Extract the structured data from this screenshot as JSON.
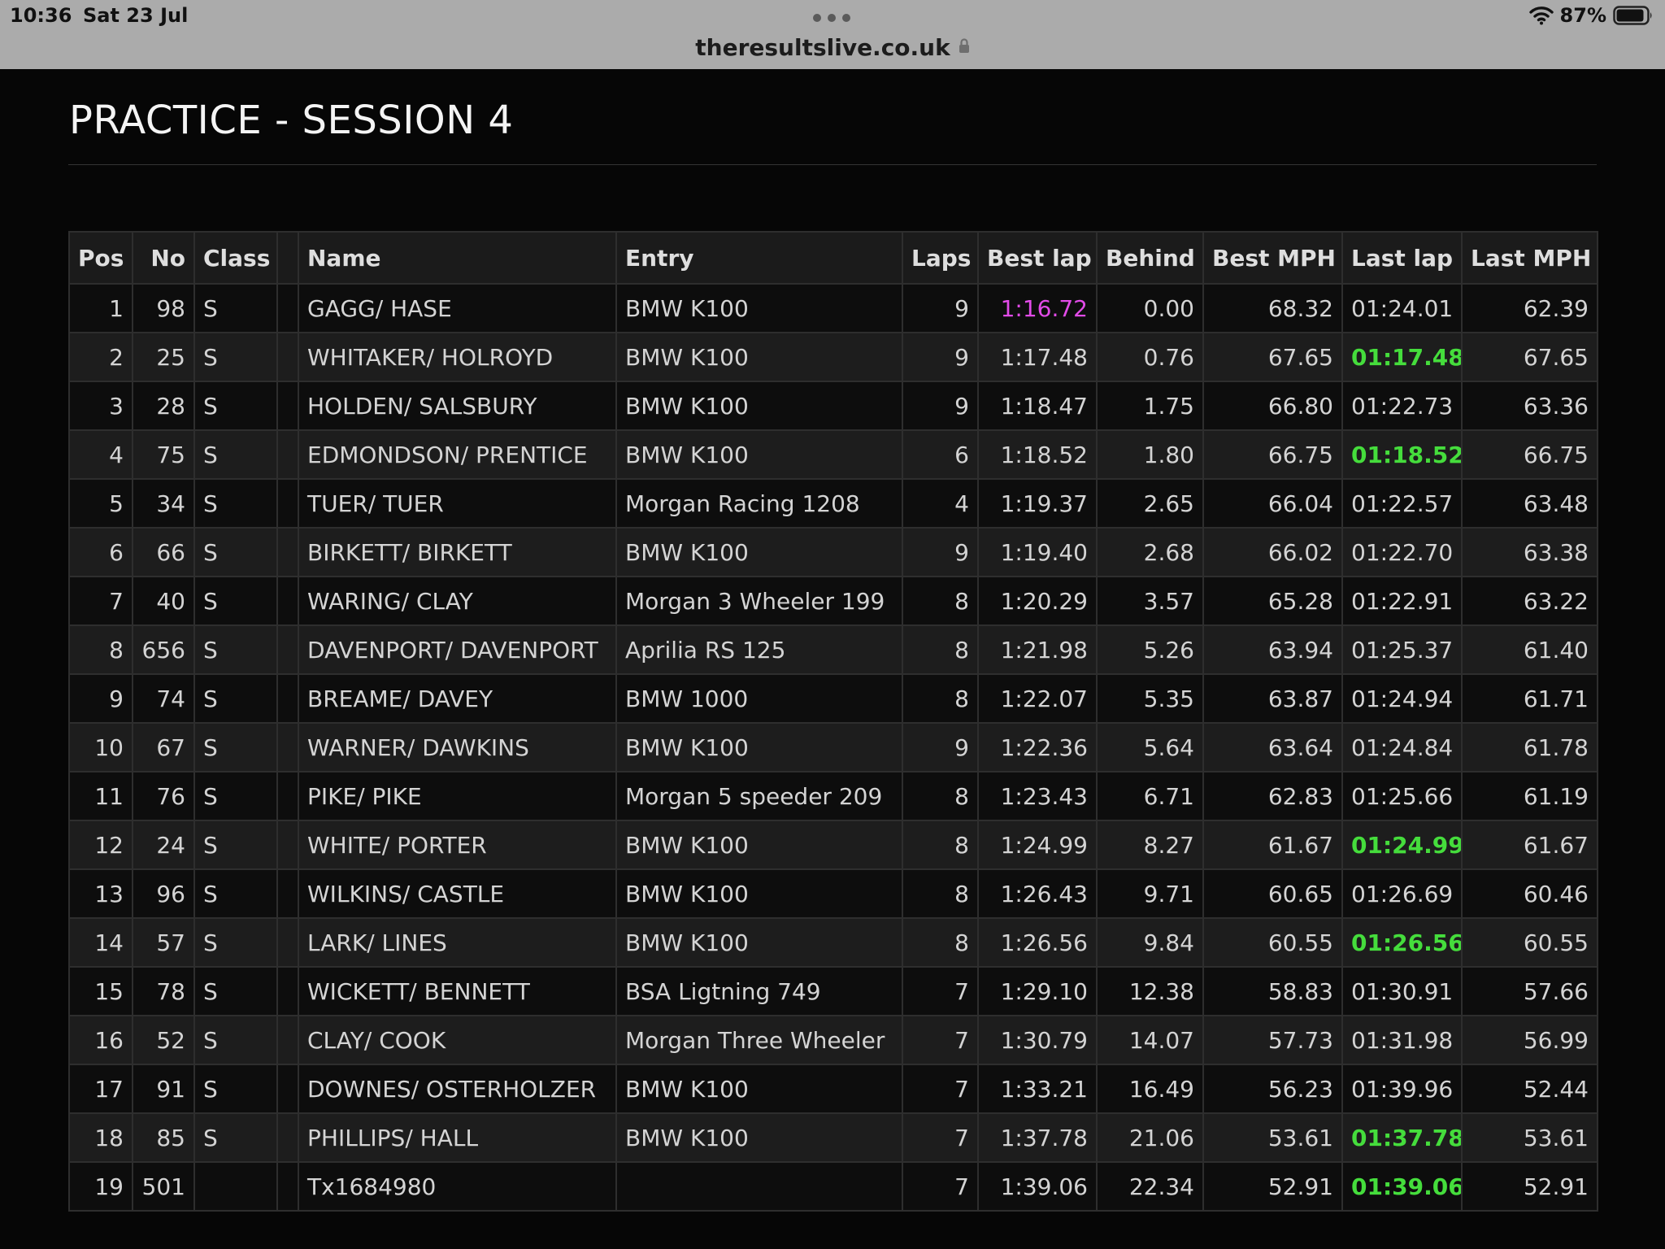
{
  "status_bar": {
    "time": "10:36",
    "date": "Sat 23 Jul",
    "battery": "87%"
  },
  "browser": {
    "url": "theresultslive.co.uk",
    "icons": [
      "lock-icon",
      "wifi-icon",
      "battery-icon",
      "more-dots-icon"
    ]
  },
  "page": {
    "title": "PRACTICE - SESSION 4"
  },
  "colors": {
    "fastest_overall": "#e24be8",
    "personal_best": "#45dd3c"
  },
  "table": {
    "headers": [
      "Pos",
      "No",
      "Class",
      "",
      "Name",
      "Entry",
      "Laps",
      "Best lap",
      "Behind",
      "Best MPH",
      "Last lap",
      "Last MPH"
    ],
    "rows": [
      {
        "pos": "1",
        "no": "98",
        "class": "S",
        "name": "GAGG/ HASE",
        "entry": "BMW K100",
        "laps": "9",
        "best_lap": "1:16.72",
        "behind": "0.00",
        "best_mph": "68.32",
        "last_lap": "01:24.01",
        "last_mph": "62.39",
        "best_lap_style": "purple",
        "last_lap_style": ""
      },
      {
        "pos": "2",
        "no": "25",
        "class": "S",
        "name": "WHITAKER/ HOLROYD",
        "entry": "BMW K100",
        "laps": "9",
        "best_lap": "1:17.48",
        "behind": "0.76",
        "best_mph": "67.65",
        "last_lap": "01:17.48",
        "last_mph": "67.65",
        "best_lap_style": "",
        "last_lap_style": "green"
      },
      {
        "pos": "3",
        "no": "28",
        "class": "S",
        "name": "HOLDEN/ SALSBURY",
        "entry": "BMW K100",
        "laps": "9",
        "best_lap": "1:18.47",
        "behind": "1.75",
        "best_mph": "66.80",
        "last_lap": "01:22.73",
        "last_mph": "63.36",
        "best_lap_style": "",
        "last_lap_style": ""
      },
      {
        "pos": "4",
        "no": "75",
        "class": "S",
        "name": "EDMONDSON/ PRENTICE",
        "entry": "BMW K100",
        "laps": "6",
        "best_lap": "1:18.52",
        "behind": "1.80",
        "best_mph": "66.75",
        "last_lap": "01:18.52",
        "last_mph": "66.75",
        "best_lap_style": "",
        "last_lap_style": "green"
      },
      {
        "pos": "5",
        "no": "34",
        "class": "S",
        "name": "TUER/ TUER",
        "entry": "Morgan Racing 1208",
        "laps": "4",
        "best_lap": "1:19.37",
        "behind": "2.65",
        "best_mph": "66.04",
        "last_lap": "01:22.57",
        "last_mph": "63.48",
        "best_lap_style": "",
        "last_lap_style": ""
      },
      {
        "pos": "6",
        "no": "66",
        "class": "S",
        "name": "BIRKETT/ BIRKETT",
        "entry": "BMW K100",
        "laps": "9",
        "best_lap": "1:19.40",
        "behind": "2.68",
        "best_mph": "66.02",
        "last_lap": "01:22.70",
        "last_mph": "63.38",
        "best_lap_style": "",
        "last_lap_style": ""
      },
      {
        "pos": "7",
        "no": "40",
        "class": "S",
        "name": "WARING/ CLAY",
        "entry": "Morgan 3 Wheeler 199",
        "laps": "8",
        "best_lap": "1:20.29",
        "behind": "3.57",
        "best_mph": "65.28",
        "last_lap": "01:22.91",
        "last_mph": "63.22",
        "best_lap_style": "",
        "last_lap_style": ""
      },
      {
        "pos": "8",
        "no": "656",
        "class": "S",
        "name": "DAVENPORT/ DAVENPORT",
        "entry": "Aprilia RS 125",
        "laps": "8",
        "best_lap": "1:21.98",
        "behind": "5.26",
        "best_mph": "63.94",
        "last_lap": "01:25.37",
        "last_mph": "61.40",
        "best_lap_style": "",
        "last_lap_style": ""
      },
      {
        "pos": "9",
        "no": "74",
        "class": "S",
        "name": "BREAME/ DAVEY",
        "entry": "BMW 1000",
        "laps": "8",
        "best_lap": "1:22.07",
        "behind": "5.35",
        "best_mph": "63.87",
        "last_lap": "01:24.94",
        "last_mph": "61.71",
        "best_lap_style": "",
        "last_lap_style": ""
      },
      {
        "pos": "10",
        "no": "67",
        "class": "S",
        "name": "WARNER/ DAWKINS",
        "entry": "BMW K100",
        "laps": "9",
        "best_lap": "1:22.36",
        "behind": "5.64",
        "best_mph": "63.64",
        "last_lap": "01:24.84",
        "last_mph": "61.78",
        "best_lap_style": "",
        "last_lap_style": ""
      },
      {
        "pos": "11",
        "no": "76",
        "class": "S",
        "name": "PIKE/ PIKE",
        "entry": "Morgan 5 speeder 209",
        "laps": "8",
        "best_lap": "1:23.43",
        "behind": "6.71",
        "best_mph": "62.83",
        "last_lap": "01:25.66",
        "last_mph": "61.19",
        "best_lap_style": "",
        "last_lap_style": ""
      },
      {
        "pos": "12",
        "no": "24",
        "class": "S",
        "name": "WHITE/ PORTER",
        "entry": "BMW K100",
        "laps": "8",
        "best_lap": "1:24.99",
        "behind": "8.27",
        "best_mph": "61.67",
        "last_lap": "01:24.99",
        "last_mph": "61.67",
        "best_lap_style": "",
        "last_lap_style": "green"
      },
      {
        "pos": "13",
        "no": "96",
        "class": "S",
        "name": "WILKINS/ CASTLE",
        "entry": "BMW K100",
        "laps": "8",
        "best_lap": "1:26.43",
        "behind": "9.71",
        "best_mph": "60.65",
        "last_lap": "01:26.69",
        "last_mph": "60.46",
        "best_lap_style": "",
        "last_lap_style": ""
      },
      {
        "pos": "14",
        "no": "57",
        "class": "S",
        "name": "LARK/ LINES",
        "entry": "BMW K100",
        "laps": "8",
        "best_lap": "1:26.56",
        "behind": "9.84",
        "best_mph": "60.55",
        "last_lap": "01:26.56",
        "last_mph": "60.55",
        "best_lap_style": "",
        "last_lap_style": "green"
      },
      {
        "pos": "15",
        "no": "78",
        "class": "S",
        "name": "WICKETT/ BENNETT",
        "entry": "BSA Ligtning 749",
        "laps": "7",
        "best_lap": "1:29.10",
        "behind": "12.38",
        "best_mph": "58.83",
        "last_lap": "01:30.91",
        "last_mph": "57.66",
        "best_lap_style": "",
        "last_lap_style": ""
      },
      {
        "pos": "16",
        "no": "52",
        "class": "S",
        "name": "CLAY/ COOK",
        "entry": "Morgan Three Wheeler",
        "laps": "7",
        "best_lap": "1:30.79",
        "behind": "14.07",
        "best_mph": "57.73",
        "last_lap": "01:31.98",
        "last_mph": "56.99",
        "best_lap_style": "",
        "last_lap_style": ""
      },
      {
        "pos": "17",
        "no": "91",
        "class": "S",
        "name": "DOWNES/ OSTERHOLZER",
        "entry": "BMW K100",
        "laps": "7",
        "best_lap": "1:33.21",
        "behind": "16.49",
        "best_mph": "56.23",
        "last_lap": "01:39.96",
        "last_mph": "52.44",
        "best_lap_style": "",
        "last_lap_style": ""
      },
      {
        "pos": "18",
        "no": "85",
        "class": "S",
        "name": "PHILLIPS/ HALL",
        "entry": "BMW K100",
        "laps": "7",
        "best_lap": "1:37.78",
        "behind": "21.06",
        "best_mph": "53.61",
        "last_lap": "01:37.78",
        "last_mph": "53.61",
        "best_lap_style": "",
        "last_lap_style": "green"
      },
      {
        "pos": "19",
        "no": "501",
        "class": "",
        "name": "Tx1684980",
        "entry": "",
        "laps": "7",
        "best_lap": "1:39.06",
        "behind": "22.34",
        "best_mph": "52.91",
        "last_lap": "01:39.06",
        "last_mph": "52.91",
        "best_lap_style": "",
        "last_lap_style": "green"
      }
    ]
  }
}
